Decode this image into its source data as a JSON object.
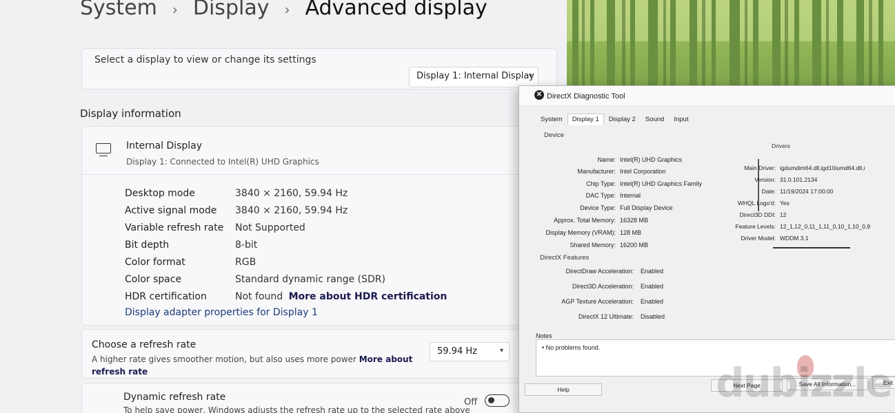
{
  "breadcrumb": {
    "items": [
      "System",
      "Display",
      "Advanced display"
    ]
  },
  "select_display": {
    "label": "Select a display to view or change its settings",
    "value": "Display 1: Internal Display"
  },
  "display_info": {
    "section_title": "Display information",
    "name": "Internal Display",
    "subtitle": "Display 1: Connected to Intel(R) UHD Graphics",
    "rows": [
      {
        "key": "Desktop mode",
        "value": "3840 × 2160, 59.94 Hz"
      },
      {
        "key": "Active signal mode",
        "value": "3840 × 2160, 59.94 Hz"
      },
      {
        "key": "Variable refresh rate",
        "value": "Not Supported"
      },
      {
        "key": "Bit depth",
        "value": "8-bit"
      },
      {
        "key": "Color format",
        "value": "RGB"
      },
      {
        "key": "Color space",
        "value": "Standard dynamic range (SDR)"
      },
      {
        "key": "HDR certification",
        "value": "Not found",
        "link": "More about HDR certification"
      }
    ],
    "adapter_link": "Display adapter properties for Display 1"
  },
  "refresh": {
    "title": "Choose a refresh rate",
    "desc": "A higher rate gives smoother motion, but also uses more power",
    "link": "More about refresh rate",
    "value": "59.94 Hz"
  },
  "dynamic_refresh": {
    "title": "Dynamic refresh rate",
    "desc": "To help save power, Windows adjusts the refresh rate up to the selected rate above",
    "state": "Off"
  },
  "dxdiag": {
    "title": "DirectX Diagnostic Tool",
    "tabs": [
      "System",
      "Display 1",
      "Display 2",
      "Sound",
      "Input"
    ],
    "active_tab": "Display 1",
    "device_label": "Device",
    "device": [
      {
        "k": "Name:",
        "v": "Intel(R) UHD Graphics"
      },
      {
        "k": "Manufacturer:",
        "v": "Intel Corporation"
      },
      {
        "k": "Chip Type:",
        "v": "Intel(R) UHD Graphics Family"
      },
      {
        "k": "DAC Type:",
        "v": "Internal"
      },
      {
        "k": "Device Type:",
        "v": "Full Display Device"
      },
      {
        "k": "Approx. Total Memory:",
        "v": "16328 MB"
      },
      {
        "k": "Display Memory (VRAM):",
        "v": "128 MB"
      },
      {
        "k": "Shared Memory:",
        "v": "16200 MB"
      }
    ],
    "drivers_label": "Drivers",
    "drivers": [
      {
        "k": "Main Driver:",
        "v": "igdumdim64.dll,igd10iumd64.dll,i"
      },
      {
        "k": "Version:",
        "v": "31.0.101.2134"
      },
      {
        "k": "Date:",
        "v": "11/19/2024 17:00:00"
      },
      {
        "k": "WHQL Logo'd:",
        "v": "Yes"
      },
      {
        "k": "Direct3D DDI:",
        "v": "12"
      },
      {
        "k": "Feature Levels:",
        "v": "12_1,12_0,11_1,11_0,10_1,10_0,9"
      },
      {
        "k": "Driver Model:",
        "v": "WDDM 3.1"
      }
    ],
    "features_label": "DirectX Features",
    "features": [
      {
        "k": "DirectDraw Acceleration:",
        "v": "Enabled"
      },
      {
        "k": "Direct3D Acceleration:",
        "v": "Enabled"
      },
      {
        "k": "AGP Texture Acceleration:",
        "v": "Enabled"
      },
      {
        "k": "DirectX 12 Ultimate:",
        "v": "Disabled"
      }
    ],
    "notes_label": "Notes",
    "notes": "No problems found.",
    "buttons": {
      "help": "Help",
      "next": "Next Page",
      "save": "Save All Information...",
      "exit": "Exit"
    }
  },
  "watermark": "dubizzle",
  "colors": {
    "settings_bg": "#f1f1f4",
    "card_bg": "#f8f8fa",
    "link": "#1a3a7a",
    "bamboo": "#7da844"
  }
}
